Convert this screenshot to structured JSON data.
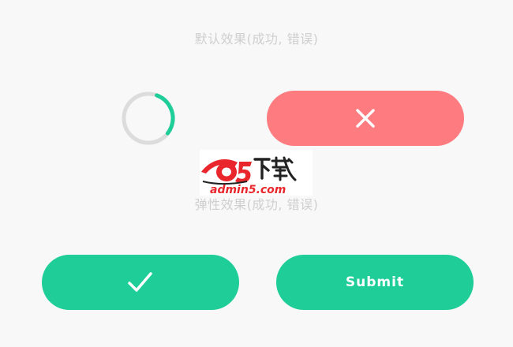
{
  "sections": {
    "default_title": "默认效果(成功, 错误)",
    "elastic_title": "弹性效果(成功, 错误)"
  },
  "buttons": {
    "submit_label": "Submit",
    "error_icon": "close-icon",
    "success_icon": "checkmark-icon"
  },
  "spinner": {
    "progress": 0.3
  },
  "watermark": {
    "brand": "a5下载",
    "domain": "admin5.com"
  },
  "colors": {
    "background": "#f8f8f8",
    "success": "#1fcd98",
    "error": "#fe7b80",
    "spinner_track": "#dcdcdc",
    "title_text": "#cfcfcf"
  }
}
